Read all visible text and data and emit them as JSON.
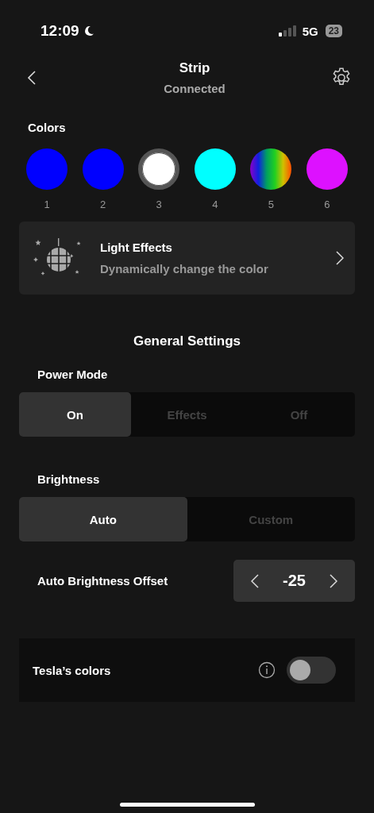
{
  "status_bar": {
    "time": "12:09",
    "network": "5G",
    "battery": "23"
  },
  "header": {
    "title": "Strip",
    "subtitle": "Connected"
  },
  "colors": {
    "title": "Colors",
    "swatches": [
      {
        "label": "1",
        "kind": "solid",
        "color": "#0000ff",
        "selected": false
      },
      {
        "label": "2",
        "kind": "solid",
        "color": "#0000ff",
        "selected": false
      },
      {
        "label": "3",
        "kind": "solid",
        "color": "#ffffff",
        "selected": true
      },
      {
        "label": "4",
        "kind": "solid",
        "color": "#00ffff",
        "selected": false
      },
      {
        "label": "5",
        "kind": "rainbow",
        "selected": false
      },
      {
        "label": "6",
        "kind": "solid",
        "color": "#dd11ff",
        "selected": false
      }
    ]
  },
  "light_effects": {
    "title": "Light Effects",
    "subtitle": "Dynamically change the color"
  },
  "general_settings": {
    "title": "General Settings",
    "power_mode": {
      "label": "Power Mode",
      "options": [
        {
          "label": "On",
          "selected": true
        },
        {
          "label": "Effects",
          "selected": false
        },
        {
          "label": "Off",
          "selected": false
        }
      ]
    },
    "brightness": {
      "label": "Brightness",
      "options": [
        {
          "label": "Auto",
          "selected": true
        },
        {
          "label": "Custom",
          "selected": false
        }
      ]
    },
    "offset": {
      "label": "Auto Brightness Offset",
      "value": "-25"
    }
  },
  "tesla_colors": {
    "label": "Tesla’s colors",
    "on": false
  }
}
